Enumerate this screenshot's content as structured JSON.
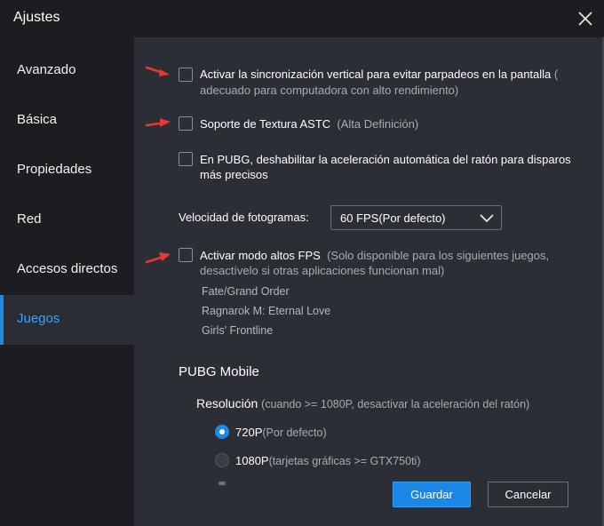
{
  "window": {
    "title": "Ajustes"
  },
  "sidebar": {
    "items": [
      {
        "label": "Avanzado"
      },
      {
        "label": "Básica"
      },
      {
        "label": "Propiedades"
      },
      {
        "label": "Red"
      },
      {
        "label": "Accesos directos"
      },
      {
        "label": "Juegos",
        "active": true
      }
    ]
  },
  "options": {
    "vsync": {
      "label": "Activar la sincronización vertical para evitar parpadeos en la pantalla",
      "hint_open": "(",
      "hint": "adecuado para computadora con alto rendimiento)",
      "checked": false
    },
    "astc": {
      "label": "Soporte de Textura ASTC",
      "hint": "(Alta Definición)",
      "checked": false
    },
    "pubg_mouse": {
      "label_line1": "En PUBG, deshabilitar la aceleración automática del ratón para disparos",
      "label_line2": "más precisos",
      "checked": false
    },
    "fps": {
      "label": "Velocidad de fotogramas:",
      "value": "60 FPS(Por defecto)"
    },
    "high_fps": {
      "label": "Activar modo altos FPS",
      "hint_line1": "(Solo disponible para los siguientes juegos,",
      "hint_line2": "desactívelo si otras aplicaciones funcionan mal)",
      "checked": false,
      "games": [
        "Fate/Grand Order",
        "Ragnarok M: Eternal Love",
        "Girls' Frontline"
      ]
    }
  },
  "pubg": {
    "title": "PUBG Mobile",
    "resolution_label": "Resolución",
    "resolution_hint": "(cuando >= 1080P, desactivar la aceleración del ratón)",
    "options": [
      {
        "label": "720P",
        "hint": "(Por defecto)",
        "selected": true
      },
      {
        "label": "1080P",
        "hint": "(tarjetas gráficas >= GTX750ti)",
        "selected": false
      }
    ]
  },
  "footer": {
    "save_label": "Guardar",
    "cancel_label": "Cancelar"
  },
  "colors": {
    "accent": "#1e88e5",
    "annotation_arrow": "#e53935",
    "panel": "#2b2e34",
    "sidebar": "#1c1d20"
  }
}
